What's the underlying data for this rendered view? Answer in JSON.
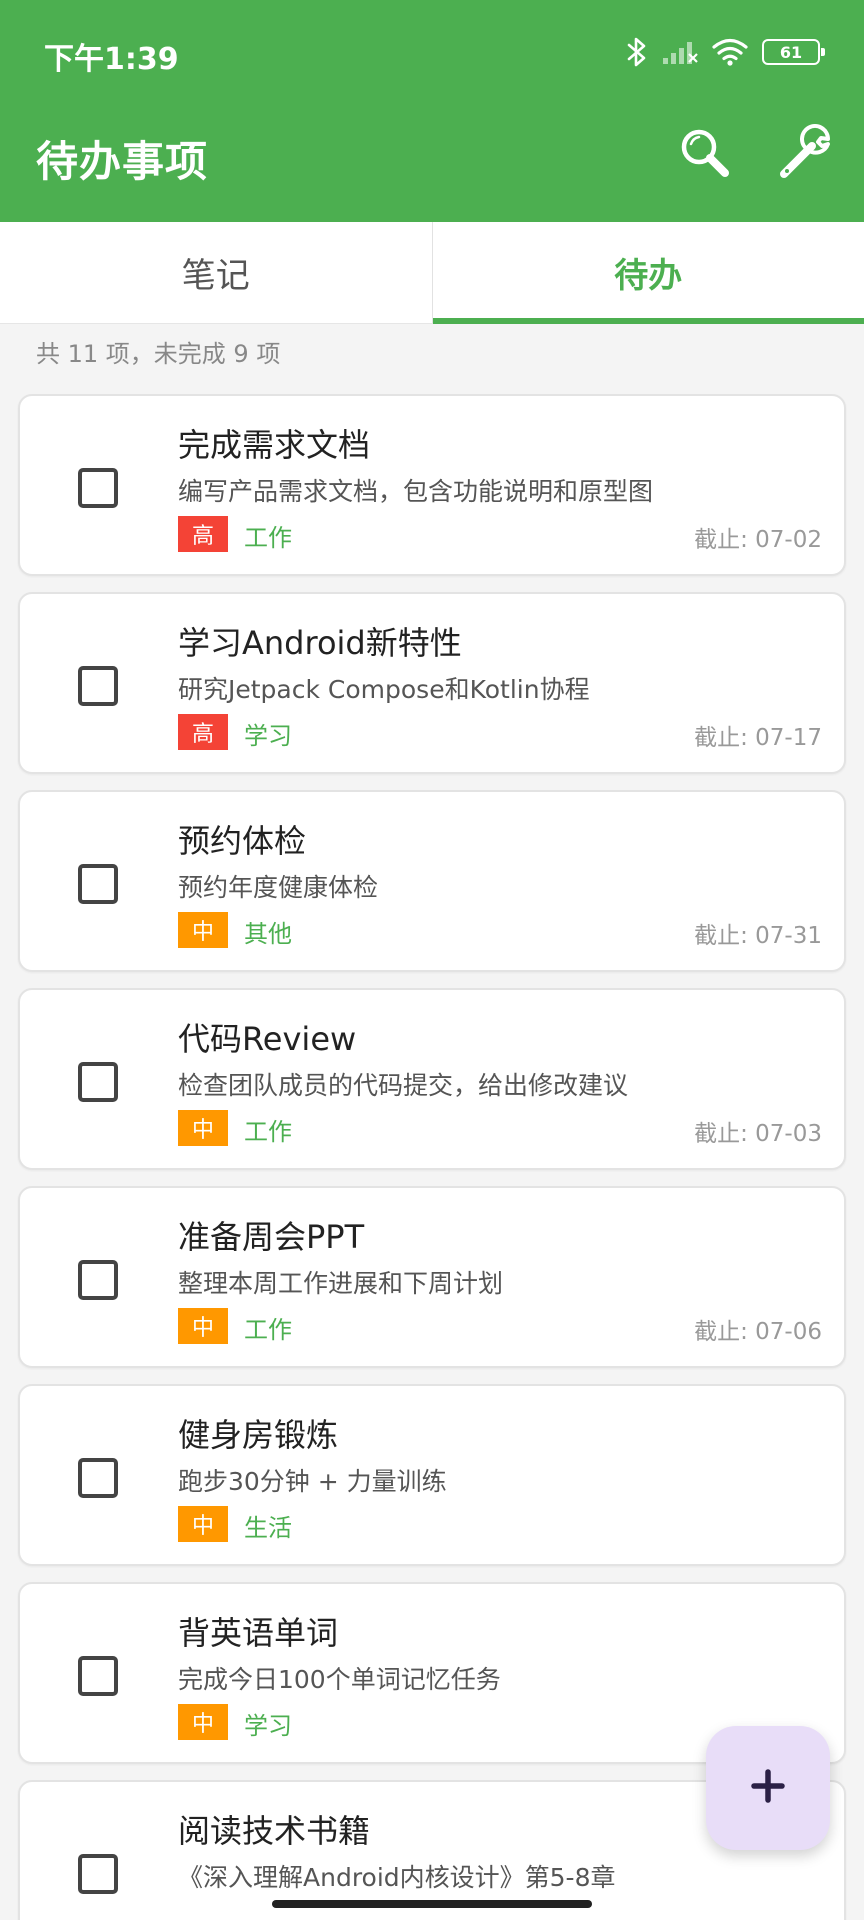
{
  "status_bar": {
    "time": "下午1:39",
    "battery": "61"
  },
  "header": {
    "title": "待办事项"
  },
  "tabs": [
    {
      "label": "笔记",
      "active": false
    },
    {
      "label": "待办",
      "active": true
    }
  ],
  "summary": "共 11 项，未完成 9 项",
  "colors": {
    "primary": "#4caf50",
    "priority_high": "#f44336",
    "priority_medium": "#ff9800",
    "fab": "#e8ddf8"
  },
  "todos": [
    {
      "title": "完成需求文档",
      "desc": "编写产品需求文档，包含功能说明和原型图",
      "priority": "高",
      "level": "high",
      "category": "工作",
      "due": "截止: 07-02"
    },
    {
      "title": "学习Android新特性",
      "desc": "研究Jetpack Compose和Kotlin协程",
      "priority": "高",
      "level": "high",
      "category": "学习",
      "due": "截止: 07-17"
    },
    {
      "title": "预约体检",
      "desc": "预约年度健康体检",
      "priority": "中",
      "level": "medium",
      "category": "其他",
      "due": "截止: 07-31"
    },
    {
      "title": "代码Review",
      "desc": "检查团队成员的代码提交，给出修改建议",
      "priority": "中",
      "level": "medium",
      "category": "工作",
      "due": "截止: 07-03"
    },
    {
      "title": "准备周会PPT",
      "desc": "整理本周工作进展和下周计划",
      "priority": "中",
      "level": "medium",
      "category": "工作",
      "due": "截止: 07-06"
    },
    {
      "title": "健身房锻炼",
      "desc": "跑步30分钟 + 力量训练",
      "priority": "中",
      "level": "medium",
      "category": "生活",
      "due": ""
    },
    {
      "title": "背英语单词",
      "desc": "完成今日100个单词记忆任务",
      "priority": "中",
      "level": "medium",
      "category": "学习",
      "due": ""
    },
    {
      "title": "阅读技术书籍",
      "desc": "《深入理解Android内核设计》第5-8章",
      "priority": "",
      "level": "",
      "category": "",
      "due": ""
    }
  ],
  "fab": {
    "icon": "plus-icon"
  }
}
